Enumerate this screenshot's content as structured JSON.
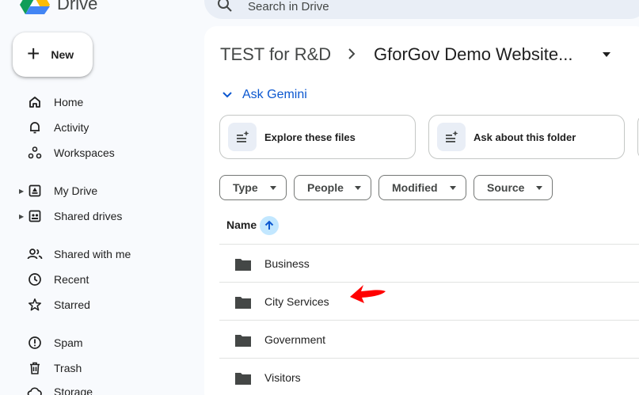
{
  "app": {
    "brand": "Drive"
  },
  "search": {
    "placeholder": "Search in Drive"
  },
  "new_button": {
    "label": "New"
  },
  "sidebar": {
    "items": [
      {
        "label": "Home",
        "icon": "home-icon"
      },
      {
        "label": "Activity",
        "icon": "bell-icon"
      },
      {
        "label": "Workspaces",
        "icon": "workspaces-icon"
      },
      {
        "label": "My Drive",
        "icon": "my-drive-icon",
        "expandable": true
      },
      {
        "label": "Shared drives",
        "icon": "shared-drives-icon",
        "expandable": true
      },
      {
        "label": "Shared with me",
        "icon": "people-icon"
      },
      {
        "label": "Recent",
        "icon": "clock-icon"
      },
      {
        "label": "Starred",
        "icon": "star-icon"
      },
      {
        "label": "Spam",
        "icon": "spam-icon"
      },
      {
        "label": "Trash",
        "icon": "trash-icon"
      },
      {
        "label": "Storage",
        "icon": "cloud-icon"
      }
    ]
  },
  "breadcrumb": {
    "parent": "TEST for R&D",
    "current": "GforGov Demo Website..."
  },
  "gemini": {
    "label": "Ask Gemini"
  },
  "gemini_cards": [
    {
      "label": "Explore these files"
    },
    {
      "label": "Ask about this folder"
    }
  ],
  "filters": [
    {
      "label": "Type"
    },
    {
      "label": "People"
    },
    {
      "label": "Modified"
    },
    {
      "label": "Source"
    }
  ],
  "table": {
    "column_name": "Name",
    "sort": "ascending",
    "rows": [
      {
        "name": "Business"
      },
      {
        "name": "City Services"
      },
      {
        "name": "Government"
      },
      {
        "name": "Visitors"
      }
    ]
  },
  "colors": {
    "accent": "#0b57d0",
    "sort_bg": "#c2e7ff",
    "annotation_arrow": "#ff0000"
  }
}
